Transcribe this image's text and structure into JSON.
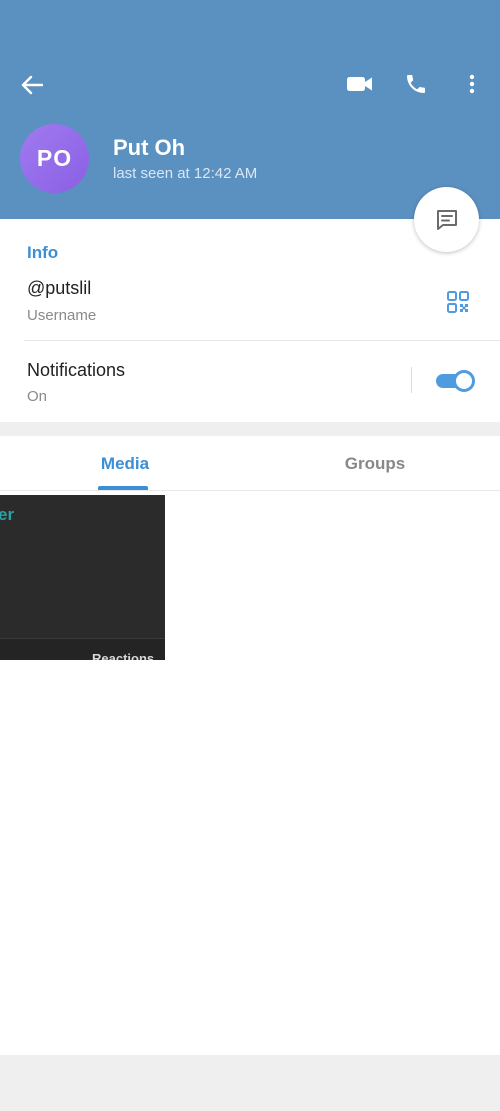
{
  "header": {
    "avatar_initials": "PO",
    "name": "Put Oh",
    "status": "last seen at 12:42 AM",
    "background_color": "#5b91c1",
    "icons": [
      "back-arrow-icon",
      "video-call-icon",
      "phone-icon",
      "more-vertical-icon"
    ]
  },
  "fab": {
    "icon": "message-icon"
  },
  "info": {
    "title": "Info",
    "username_value": "@putslil",
    "username_label": "Username",
    "qr_icon": "qr-code-icon",
    "notifications_label": "Notifications",
    "notifications_state": "On",
    "notifications_enabled": true
  },
  "tabs": {
    "items": [
      {
        "label": "Media",
        "active": true
      },
      {
        "label": "Groups",
        "active": false
      }
    ]
  },
  "media": {
    "thumbnail_caption_top": "er",
    "thumbnail_caption_bottom": "Reactions"
  },
  "colors": {
    "accent": "#3a8fd6",
    "avatar_gradient_start": "#a07bf0",
    "avatar_gradient_end": "#8a5fe3"
  }
}
